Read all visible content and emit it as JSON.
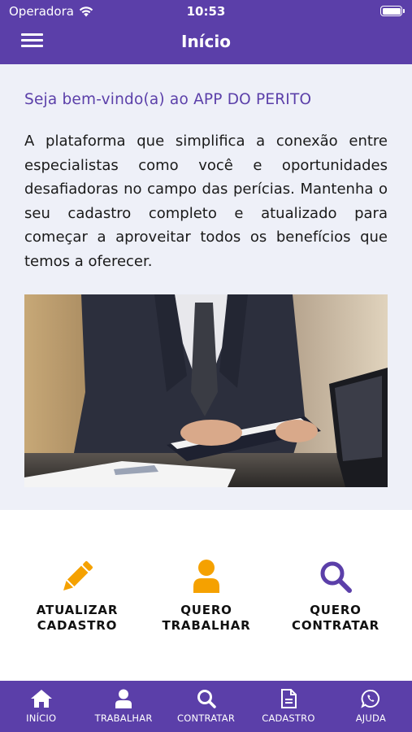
{
  "status_bar": {
    "carrier": "Operadora",
    "time": "10:53"
  },
  "nav": {
    "title": "Início"
  },
  "welcome": {
    "title": "Seja bem-vindo(a) ao APP DO PERITO",
    "text": "A plataforma que simplifica a conexão entre especialistas como você e oportunidades desafiadoras no campo das perícias. Mantenha o seu cadastro completo e atualizado para começar a aproveitar todos os benefícios que temos a oferecer."
  },
  "actions": [
    {
      "line1": "ATUALIZAR",
      "line2": "CADASTRO",
      "icon": "pencil-icon",
      "color": "#f5a100"
    },
    {
      "line1": "QUERO",
      "line2": "TRABALHAR",
      "icon": "user-icon",
      "color": "#f5a100"
    },
    {
      "line1": "QUERO",
      "line2": "CONTRATAR",
      "icon": "search-icon",
      "color": "#5b3fa9"
    }
  ],
  "tabs": [
    {
      "label": "INÍCIO",
      "icon": "home-icon"
    },
    {
      "label": "TRABALHAR",
      "icon": "user-icon"
    },
    {
      "label": "CONTRATAR",
      "icon": "search-icon"
    },
    {
      "label": "CADASTRO",
      "icon": "document-icon"
    },
    {
      "label": "AJUDA",
      "icon": "whatsapp-icon"
    }
  ],
  "colors": {
    "primary": "#5b3fa9",
    "accent": "#f5a100",
    "background": "#eef0f8"
  }
}
